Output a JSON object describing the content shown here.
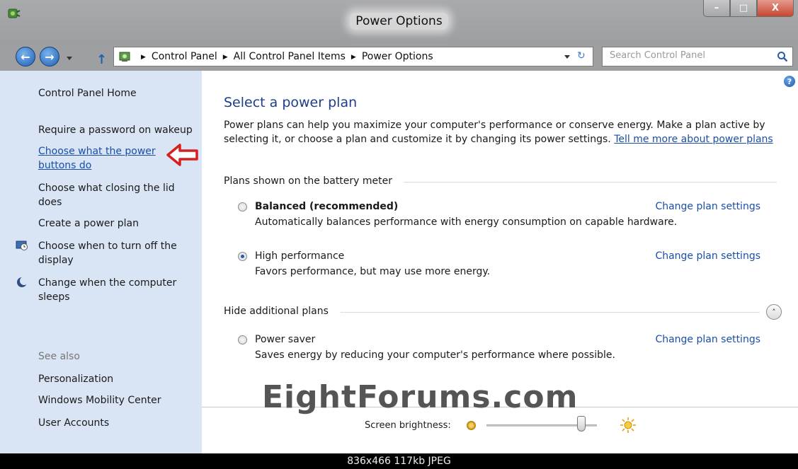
{
  "window": {
    "title": "Power Options",
    "buttons": {
      "minimize": "–",
      "maximize": "□",
      "close": "X"
    }
  },
  "nav": {
    "back_glyph": "←",
    "forward_glyph": "→",
    "up_glyph": "↑",
    "breadcrumbs": [
      "Control Panel",
      "All Control Panel Items",
      "Power Options"
    ],
    "search_placeholder": "Search Control Panel"
  },
  "sidebar": {
    "home": "Control Panel Home",
    "links": [
      {
        "label": "Require a password on wakeup",
        "icon": ""
      },
      {
        "label": "Choose what the power buttons do",
        "icon": ""
      },
      {
        "label": "Choose what closing the lid does",
        "icon": ""
      },
      {
        "label": "Create a power plan",
        "icon": ""
      },
      {
        "label": "Choose when to turn off the display",
        "icon": "display-clock-icon"
      },
      {
        "label": "Change when the computer sleeps",
        "icon": "moon-icon"
      }
    ],
    "see_also": {
      "title": "See also",
      "links": [
        "Personalization",
        "Windows Mobility Center",
        "User Accounts"
      ]
    }
  },
  "main": {
    "title": "Select a power plan",
    "description": "Power plans can help you maximize your computer's performance or conserve energy. Make a plan active by selecting it, or choose a plan and customize it by changing its power settings.",
    "tell_more": "Tell me more about power plans",
    "group1": "Plans shown on the battery meter",
    "group2": "Hide additional plans",
    "change_label": "Change plan settings",
    "plans": [
      {
        "name": "Balanced (recommended)",
        "desc": "Automatically balances performance with energy consumption on capable hardware.",
        "selected": false,
        "bold": true
      },
      {
        "name": "High performance",
        "desc": "Favors performance, but may use more energy.",
        "selected": true,
        "bold": false
      },
      {
        "name": "Power saver",
        "desc": "Saves energy by reducing your computer's performance where possible.",
        "selected": false,
        "bold": false
      }
    ],
    "collapse_glyph": "˄",
    "brightness_label": "Screen brightness:",
    "brightness_level": 0.86
  },
  "watermark": "EightForums.com",
  "status_bar": "836x466  117kb  JPEG",
  "colors": {
    "link": "#1a4fa8",
    "title": "#1e3e8c",
    "sidebar_bg": "#d9e5f5",
    "annotation_arrow": "#d62020"
  }
}
